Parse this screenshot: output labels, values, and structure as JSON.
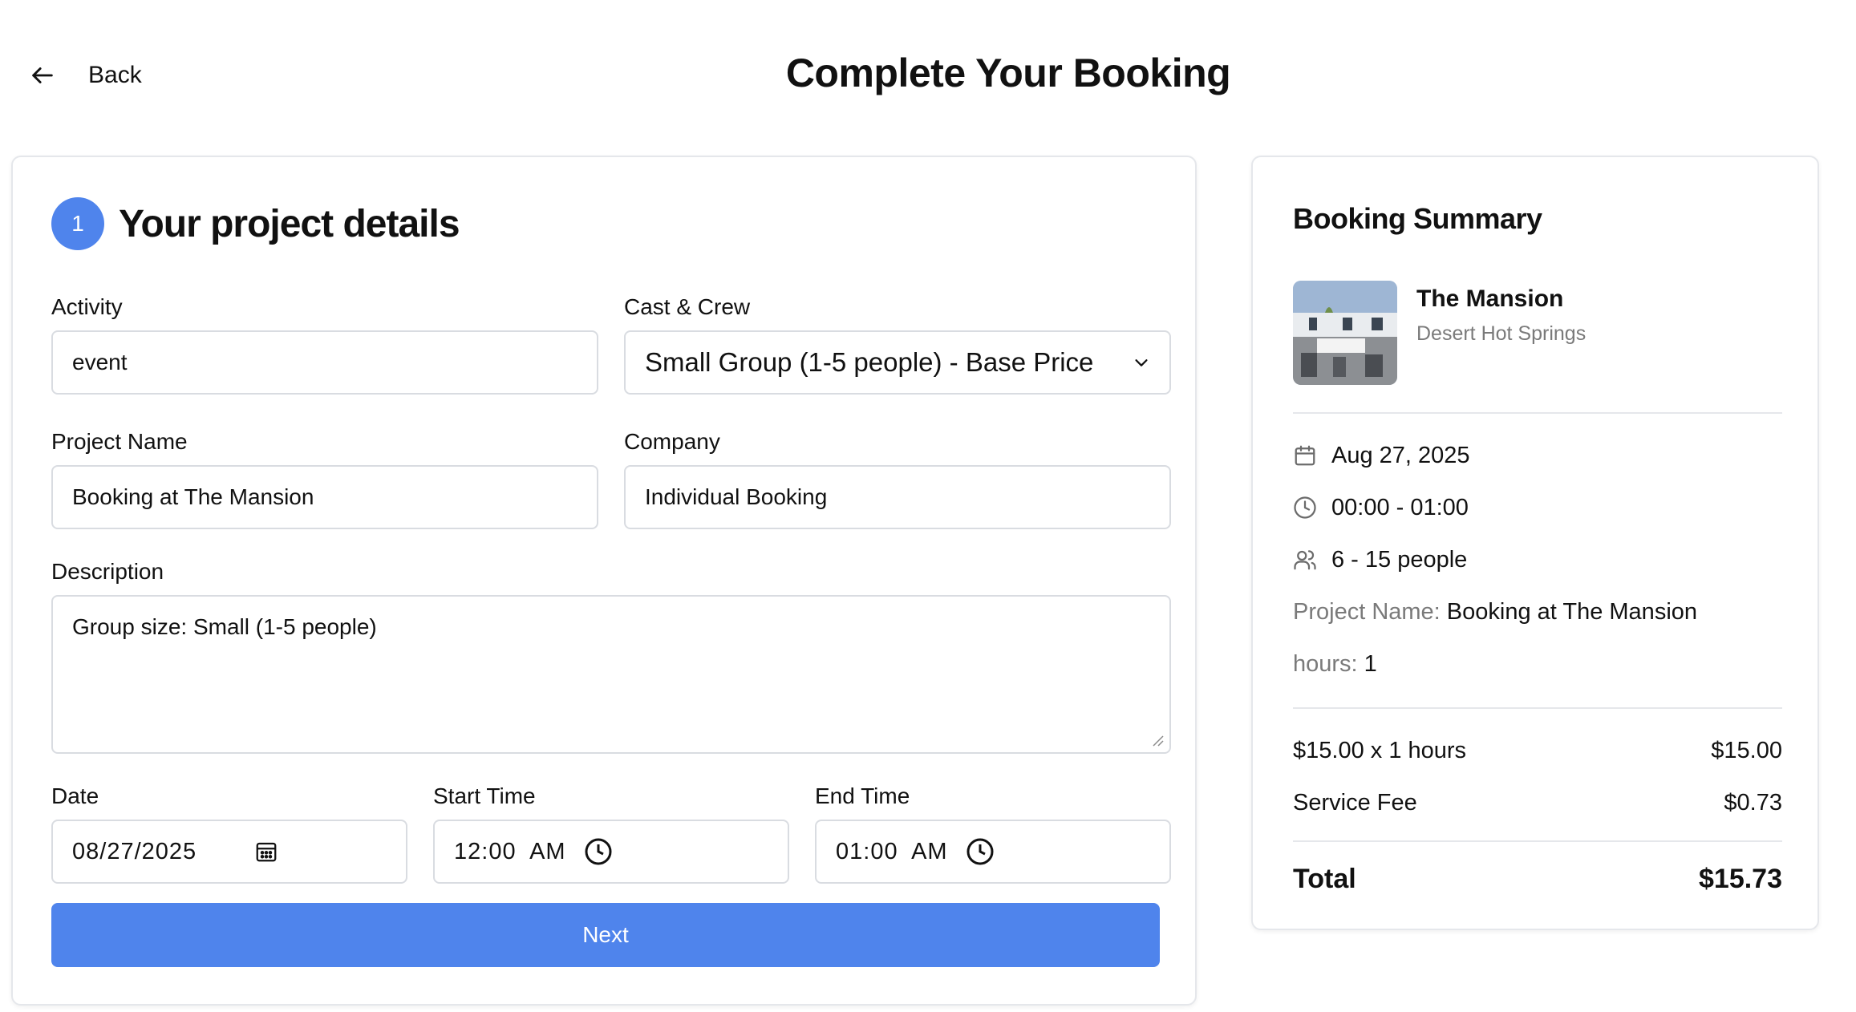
{
  "header": {
    "back_label": "Back",
    "title": "Complete Your Booking"
  },
  "form": {
    "step_number": "1",
    "step_title": "Your project details",
    "activity": {
      "label": "Activity",
      "value": "event"
    },
    "cast_crew": {
      "label": "Cast & Crew",
      "value": "Small Group (1-5 people) - Base Price"
    },
    "project_name": {
      "label": "Project Name",
      "value": "Booking at The Mansion"
    },
    "company": {
      "label": "Company",
      "value": "Individual Booking"
    },
    "description": {
      "label": "Description",
      "value": "Group size: Small (1-5 people)"
    },
    "date": {
      "label": "Date",
      "value": "08/27/2025"
    },
    "start_time": {
      "label": "Start Time",
      "value": "12:00  AM"
    },
    "end_time": {
      "label": "End Time",
      "value": "01:00  AM"
    },
    "next_label": "Next"
  },
  "summary": {
    "title": "Booking Summary",
    "venue_name": "The Mansion",
    "venue_location": "Desert Hot Springs",
    "date": "Aug 27, 2025",
    "time": "00:00 - 01:00",
    "people": "6 - 15 people",
    "project_name_key": "Project Name:",
    "project_name_value": "Booking at The Mansion",
    "hours_key": "hours:",
    "hours_value": "1",
    "rate_label": "$15.00 x 1 hours",
    "rate_amount": "$15.00",
    "fee_label": "Service Fee",
    "fee_amount": "$0.73",
    "total_label": "Total",
    "total_amount": "$15.73"
  },
  "colors": {
    "accent": "#4f84ec",
    "border": "#d9dce1",
    "muted_text": "#7a7a7a"
  },
  "icons": [
    "arrow-left-icon",
    "chevron-down-icon",
    "calendar-icon",
    "clock-icon",
    "users-icon",
    "resize-handle-icon"
  ]
}
